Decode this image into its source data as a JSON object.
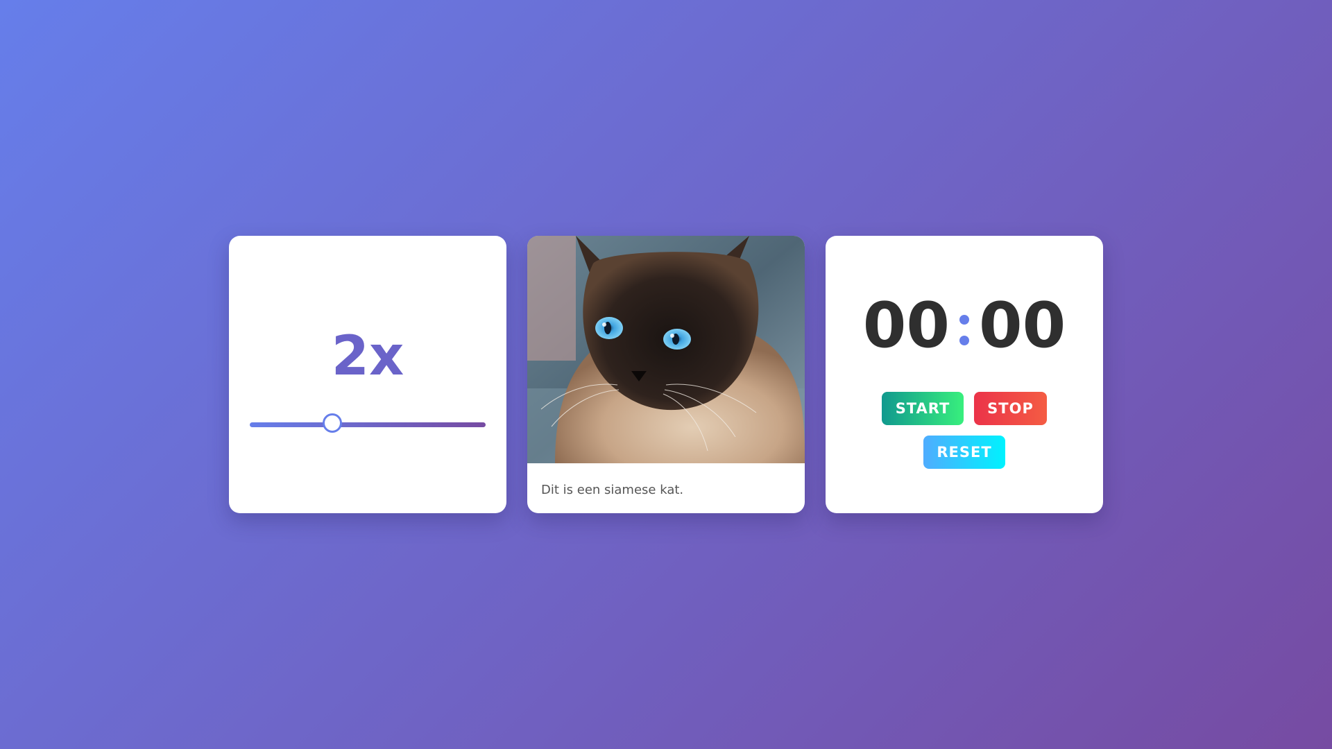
{
  "speed_card": {
    "value_label": "2x",
    "slider_fraction": 0.35
  },
  "image_card": {
    "image_subject": "siamese cat photo",
    "caption": "Dit is een siamese kat."
  },
  "timer_card": {
    "minutes": "00",
    "seconds": "00",
    "start_label": "START",
    "stop_label": "STOP",
    "reset_label": "RESET"
  },
  "colors": {
    "accent": "#667eea",
    "accent_dark": "#764ba2",
    "speed_text": "#6a63c9",
    "timer_text": "#2f2f2f"
  }
}
